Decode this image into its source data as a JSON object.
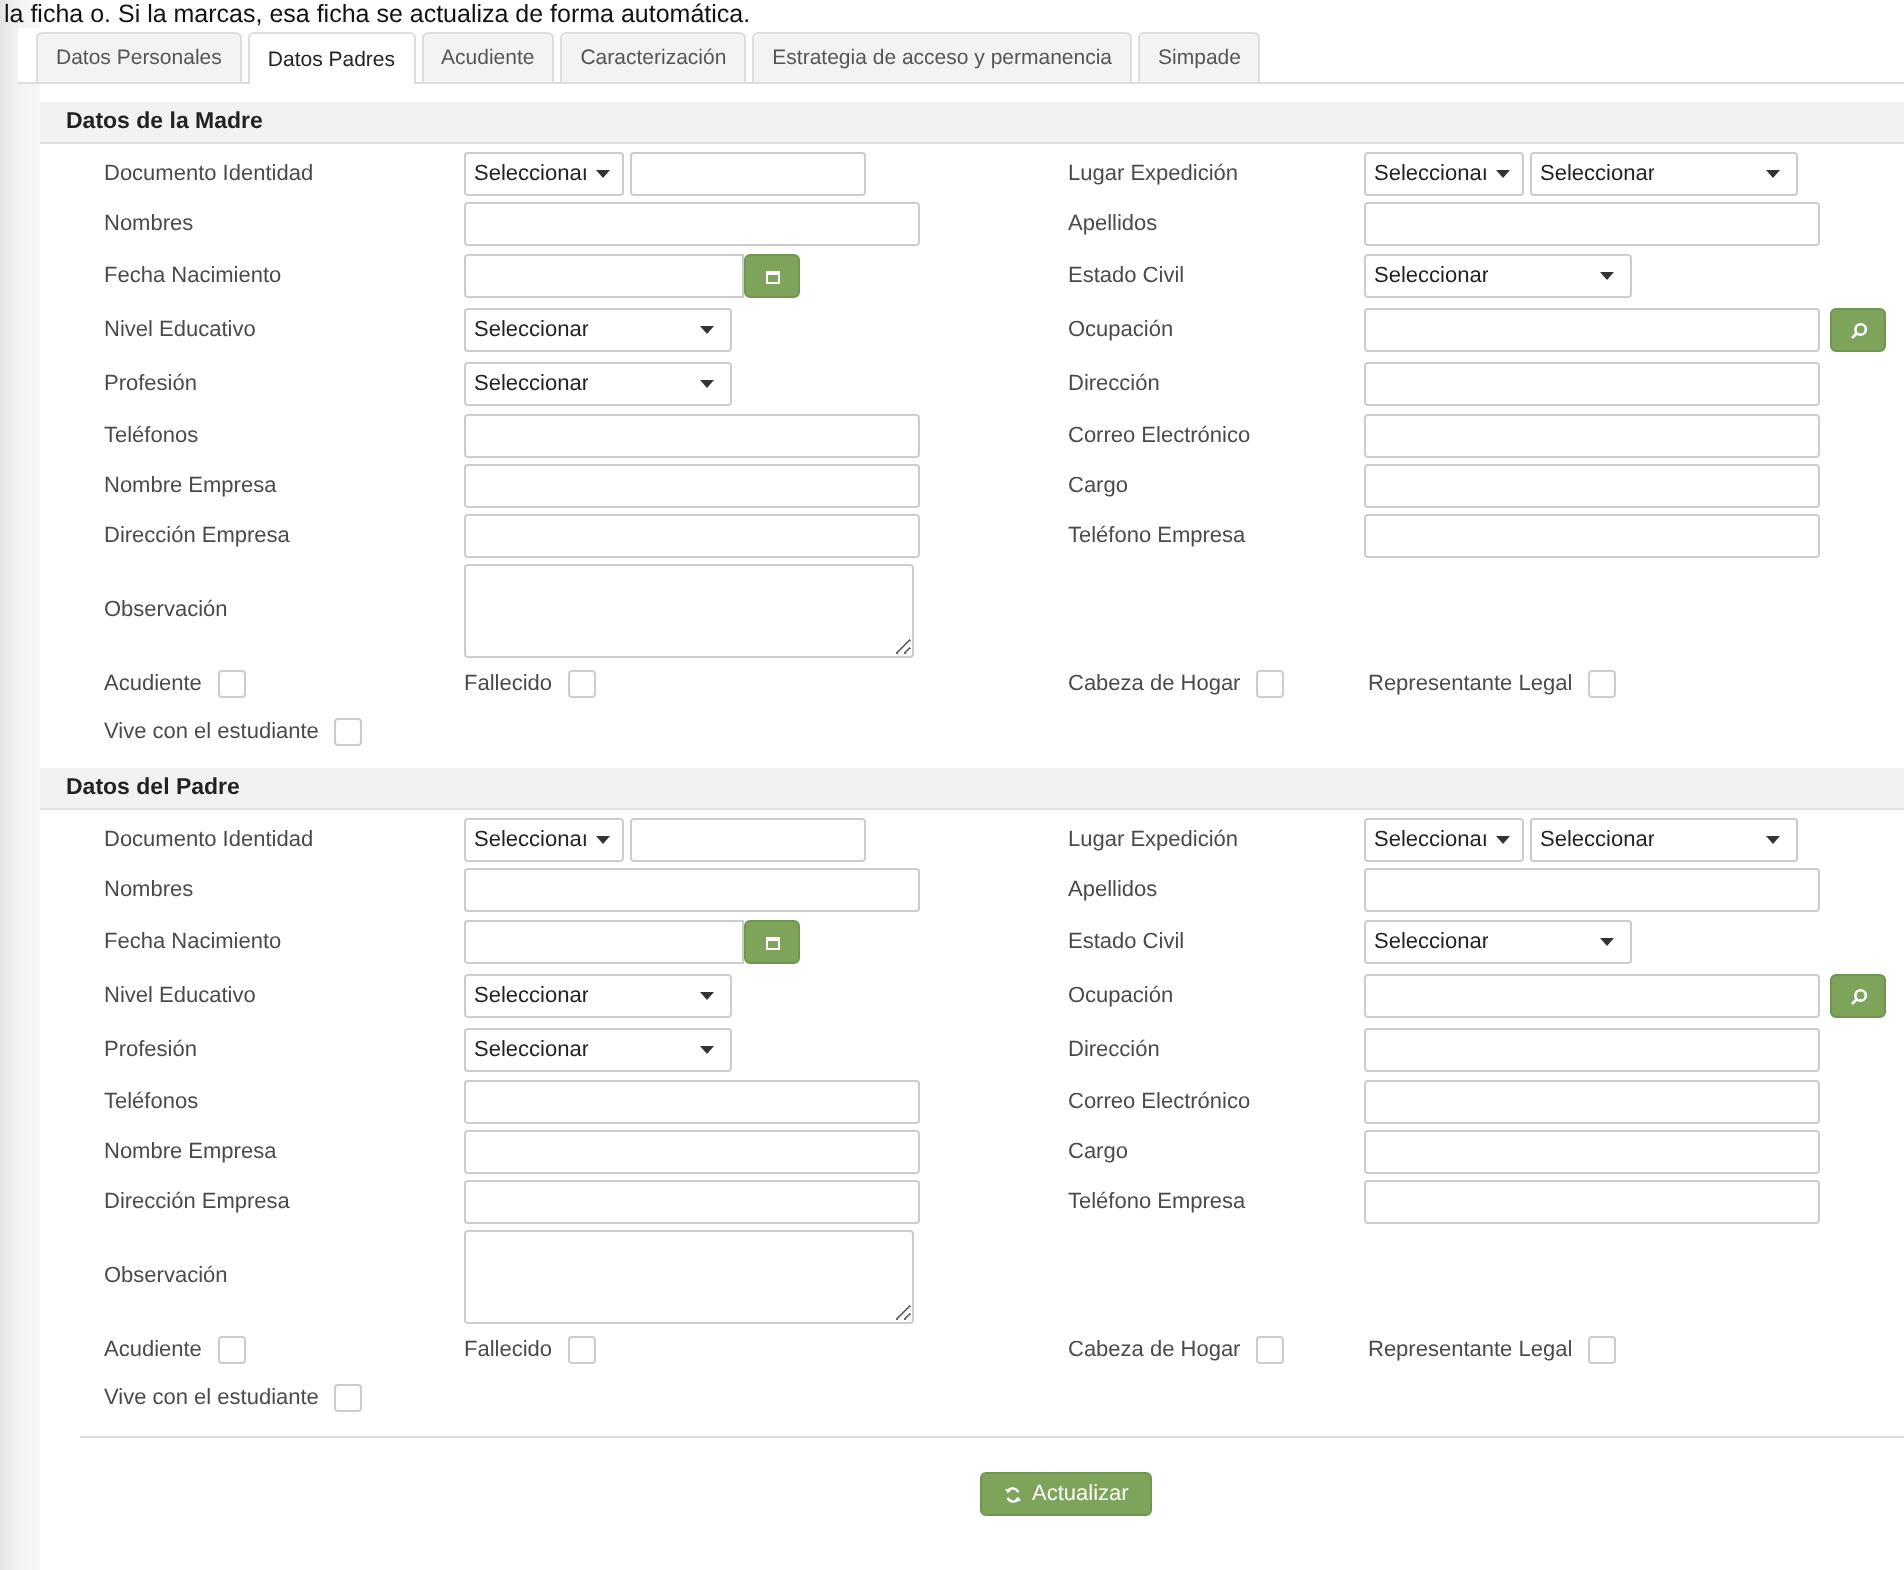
{
  "notice": "la ficha o. Si la marcas, esa ficha se actualiza de forma automática.",
  "tabs": [
    {
      "label": "Datos Personales",
      "selected": false
    },
    {
      "label": "Datos Padres",
      "selected": true
    },
    {
      "label": "Acudiente",
      "selected": false
    },
    {
      "label": "Caracterización",
      "selected": false
    },
    {
      "label": "Estrategia de acceso y permanencia",
      "selected": false
    },
    {
      "label": "Simpade",
      "selected": false
    }
  ],
  "sections": [
    {
      "title": "Datos de la Madre",
      "rows": [
        [
          {
            "label": "Documento Identidad",
            "kind": "select_input",
            "option": "Seleccionaı"
          },
          {
            "label": "Lugar Expedición",
            "kind": "select_select",
            "option": "Seleccionaı",
            "option2": "Seleccionar"
          }
        ],
        [
          {
            "label": "Nombres",
            "kind": "text"
          },
          {
            "label": "Apellidos",
            "kind": "text"
          }
        ],
        [
          {
            "label": "Fecha Nacimiento",
            "kind": "date"
          },
          {
            "label": "Estado Civil",
            "kind": "select",
            "option": "Seleccionar"
          }
        ],
        [
          {
            "label": "Nivel Educativo",
            "kind": "select",
            "option": "Seleccionar"
          },
          {
            "label": "Ocupación",
            "kind": "search"
          }
        ],
        [
          {
            "label": "Profesión",
            "kind": "select",
            "option": "Seleccionar"
          },
          {
            "label": "Dirección",
            "kind": "text"
          }
        ],
        [
          {
            "label": "Teléfonos",
            "kind": "text"
          },
          {
            "label": "Correo Electrónico",
            "kind": "text"
          }
        ],
        [
          {
            "label": "Nombre Empresa",
            "kind": "text"
          },
          {
            "label": "Cargo",
            "kind": "text"
          }
        ],
        [
          {
            "label": "Dirección Empresa",
            "kind": "text"
          },
          {
            "label": "Teléfono Empresa",
            "kind": "text"
          }
        ],
        [
          {
            "label": "Observación",
            "kind": "textarea"
          }
        ]
      ],
      "checks": [
        {
          "label": "Acudiente",
          "checked": false
        },
        {
          "label": "Fallecido",
          "checked": false
        },
        {
          "label": "Cabeza de Hogar",
          "checked": false
        },
        {
          "label": "Representante Legal",
          "checked": false
        },
        {
          "label": "Vive con el estudiante",
          "checked": false
        }
      ]
    },
    {
      "title": "Datos del Padre",
      "rows": [
        [
          {
            "label": "Documento Identidad",
            "kind": "select_input",
            "option": "Seleccionaı"
          },
          {
            "label": "Lugar Expedición",
            "kind": "select_select",
            "option": "Seleccionaı",
            "option2": "Seleccionar"
          }
        ],
        [
          {
            "label": "Nombres",
            "kind": "text"
          },
          {
            "label": "Apellidos",
            "kind": "text"
          }
        ],
        [
          {
            "label": "Fecha Nacimiento",
            "kind": "date"
          },
          {
            "label": "Estado Civil",
            "kind": "select",
            "option": "Seleccionar"
          }
        ],
        [
          {
            "label": "Nivel Educativo",
            "kind": "select",
            "option": "Seleccionar"
          },
          {
            "label": "Ocupación",
            "kind": "search"
          }
        ],
        [
          {
            "label": "Profesión",
            "kind": "select",
            "option": "Seleccionar"
          },
          {
            "label": "Dirección",
            "kind": "text"
          }
        ],
        [
          {
            "label": "Teléfonos",
            "kind": "text"
          },
          {
            "label": "Correo Electrónico",
            "kind": "text"
          }
        ],
        [
          {
            "label": "Nombre Empresa",
            "kind": "text"
          },
          {
            "label": "Cargo",
            "kind": "text"
          }
        ],
        [
          {
            "label": "Dirección Empresa",
            "kind": "text"
          },
          {
            "label": "Teléfono Empresa",
            "kind": "text"
          }
        ],
        [
          {
            "label": "Observación",
            "kind": "textarea"
          }
        ]
      ],
      "checks": [
        {
          "label": "Acudiente",
          "checked": false
        },
        {
          "label": "Fallecido",
          "checked": false
        },
        {
          "label": "Cabeza de Hogar",
          "checked": false
        },
        {
          "label": "Representante Legal",
          "checked": false
        },
        {
          "label": "Vive con el estudiante",
          "checked": false
        }
      ]
    }
  ],
  "submit": "Actualizar"
}
